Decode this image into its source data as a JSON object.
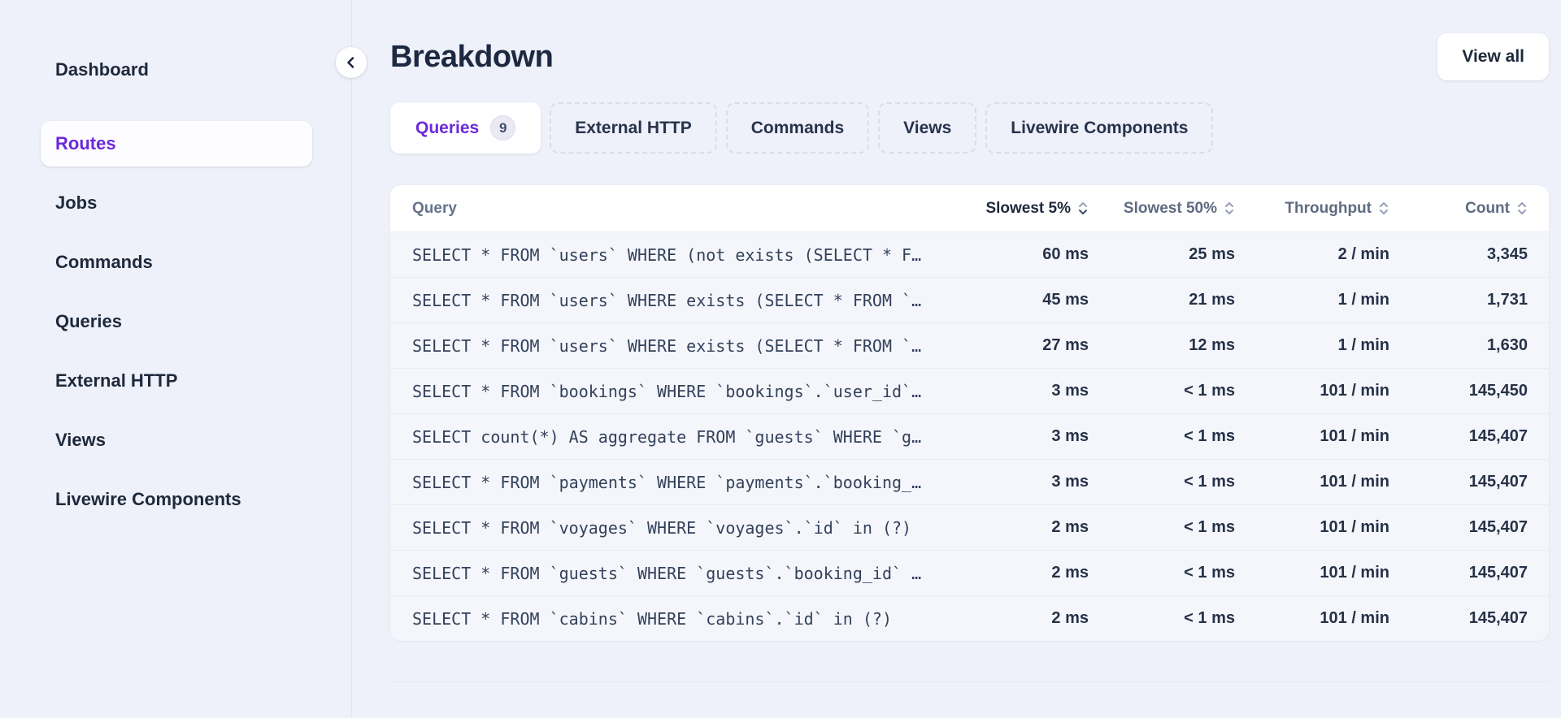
{
  "colors": {
    "accent_purple": "#6d28d9",
    "page_background": "#eef0fa",
    "card_background": "#ffffff",
    "row_background": "#f5f6fb"
  },
  "sidebar": {
    "items": [
      {
        "label": "Dashboard",
        "active": false
      },
      {
        "label": "Routes",
        "active": true
      },
      {
        "label": "Jobs",
        "active": false
      },
      {
        "label": "Commands",
        "active": false
      },
      {
        "label": "Queries",
        "active": false
      },
      {
        "label": "External HTTP",
        "active": false
      },
      {
        "label": "Views",
        "active": false
      },
      {
        "label": "Livewire Components",
        "active": false
      }
    ]
  },
  "header": {
    "title": "Breakdown",
    "view_all_label": "View all"
  },
  "tabs": [
    {
      "label": "Queries",
      "badge": "9",
      "active": true
    },
    {
      "label": "External HTTP",
      "active": false
    },
    {
      "label": "Commands",
      "active": false
    },
    {
      "label": "Views",
      "active": false
    },
    {
      "label": "Livewire Components",
      "active": false
    }
  ],
  "table": {
    "columns": [
      {
        "label": "Query",
        "sortable": false
      },
      {
        "label": "Slowest 5%",
        "sortable": true,
        "active_sort": true
      },
      {
        "label": "Slowest 50%",
        "sortable": true
      },
      {
        "label": "Throughput",
        "sortable": true
      },
      {
        "label": "Count",
        "sortable": true
      }
    ],
    "rows": [
      {
        "query": "SELECT * FROM `users` WHERE (not exists (SELECT * F…",
        "slowest5": "60 ms",
        "slowest50": "25 ms",
        "throughput": "2 / min",
        "count": "3,345"
      },
      {
        "query": "SELECT * FROM `users` WHERE exists (SELECT * FROM `…",
        "slowest5": "45 ms",
        "slowest50": "21 ms",
        "throughput": "1 / min",
        "count": "1,731"
      },
      {
        "query": "SELECT * FROM `users` WHERE exists (SELECT * FROM `…",
        "slowest5": "27 ms",
        "slowest50": "12 ms",
        "throughput": "1 / min",
        "count": "1,630"
      },
      {
        "query": "SELECT * FROM `bookings` WHERE `bookings`.`user_id`…",
        "slowest5": "3 ms",
        "slowest50": "< 1 ms",
        "throughput": "101 / min",
        "count": "145,450"
      },
      {
        "query": "SELECT count(*) AS aggregate FROM `guests` WHERE `g…",
        "slowest5": "3 ms",
        "slowest50": "< 1 ms",
        "throughput": "101 / min",
        "count": "145,407"
      },
      {
        "query": "SELECT * FROM `payments` WHERE `payments`.`booking_…",
        "slowest5": "3 ms",
        "slowest50": "< 1 ms",
        "throughput": "101 / min",
        "count": "145,407"
      },
      {
        "query": "SELECT * FROM `voyages` WHERE `voyages`.`id` in (?)",
        "slowest5": "2 ms",
        "slowest50": "< 1 ms",
        "throughput": "101 / min",
        "count": "145,407"
      },
      {
        "query": "SELECT * FROM `guests` WHERE `guests`.`booking_id` …",
        "slowest5": "2 ms",
        "slowest50": "< 1 ms",
        "throughput": "101 / min",
        "count": "145,407"
      },
      {
        "query": "SELECT * FROM `cabins` WHERE `cabins`.`id` in (?)",
        "slowest5": "2 ms",
        "slowest50": "< 1 ms",
        "throughput": "101 / min",
        "count": "145,407"
      }
    ]
  }
}
